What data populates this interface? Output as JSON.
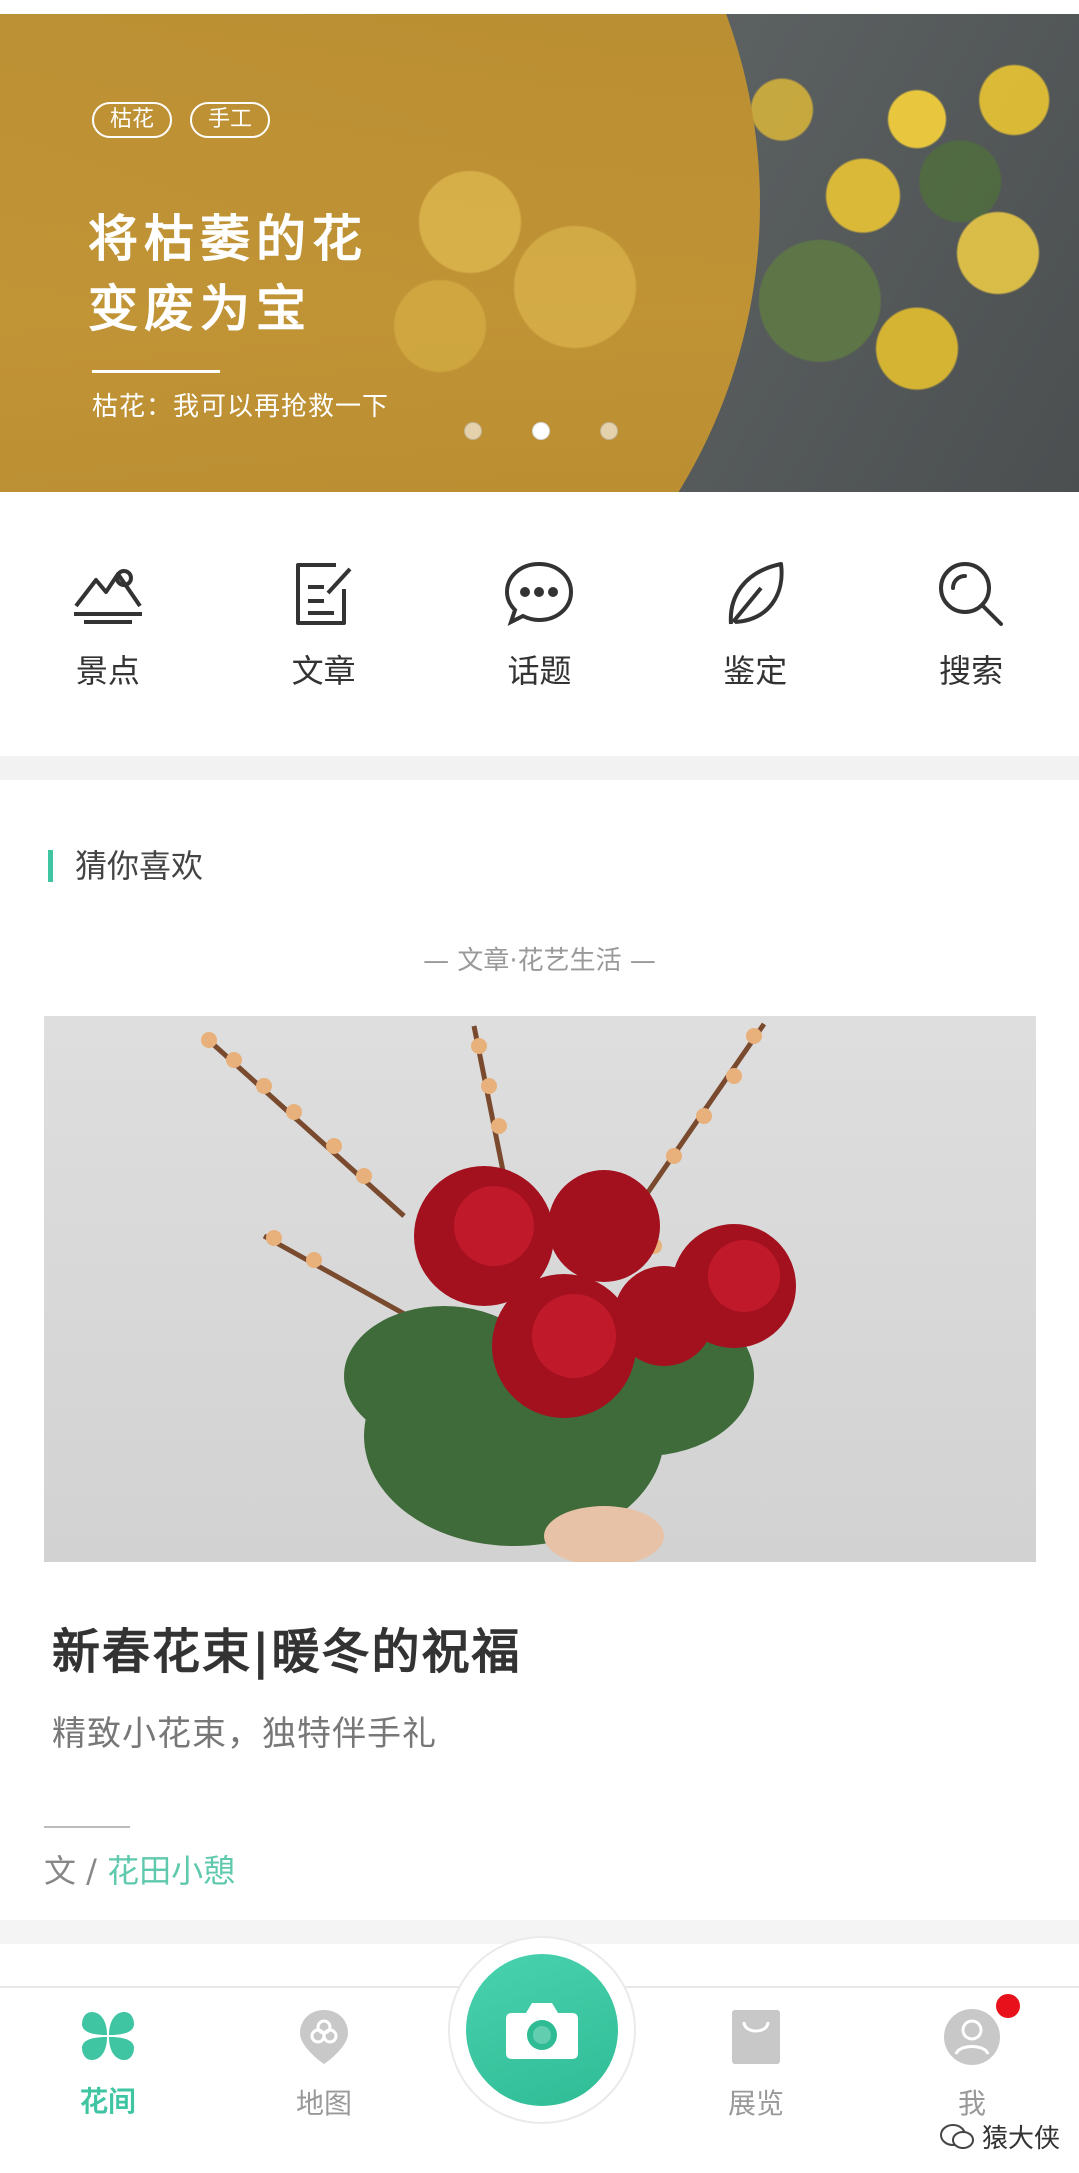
{
  "banner": {
    "tags": [
      "枯花",
      "手工"
    ],
    "title_line1": "将枯萎的花",
    "title_line2": "变废为宝",
    "subtitle": "枯花：我可以再抢救一下",
    "slides": 3,
    "active_slide": 2
  },
  "quick_nav": [
    {
      "label": "景点",
      "icon": "mountain-icon"
    },
    {
      "label": "文章",
      "icon": "article-edit-icon"
    },
    {
      "label": "话题",
      "icon": "chat-bubble-icon"
    },
    {
      "label": "鉴定",
      "icon": "leaf-icon"
    },
    {
      "label": "搜索",
      "icon": "search-icon"
    }
  ],
  "recommend": {
    "section_title": "猜你喜欢",
    "category": "—   文章·花艺生活   —",
    "article": {
      "title": "新春花束|暖冬的祝福",
      "subtitle": "精致小花束，独特伴手礼",
      "author_prefix": "文 / ",
      "author_name": "花田小憩"
    }
  },
  "tabbar": {
    "tabs": [
      {
        "label": "花间",
        "icon": "clover-icon",
        "active": true
      },
      {
        "label": "地图",
        "icon": "map-pin-icon",
        "active": false
      },
      {
        "label": "展览",
        "icon": "shopping-bag-icon",
        "active": false
      },
      {
        "label": "我",
        "icon": "user-avatar-icon",
        "active": false
      }
    ],
    "camera_icon": "camera-icon",
    "notification_dot": true
  },
  "watermark": "猿大侠",
  "colors": {
    "accent": "#3fc5a2",
    "banner_gold": "#c49533",
    "badge_red": "#e8101b"
  }
}
